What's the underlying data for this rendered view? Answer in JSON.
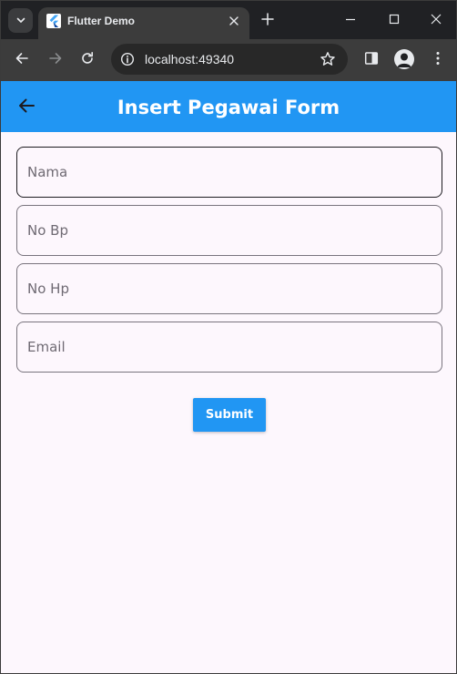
{
  "browser": {
    "tab_title": "Flutter Demo",
    "url": "localhost:49340",
    "theme_dark": "#202124",
    "toolbar_color": "#3c3c3c"
  },
  "appbar": {
    "title": "Insert Pegawai Form",
    "color": "#2196f3"
  },
  "form": {
    "fields": [
      {
        "placeholder": "Nama",
        "value": ""
      },
      {
        "placeholder": "No Bp",
        "value": ""
      },
      {
        "placeholder": "No Hp",
        "value": ""
      },
      {
        "placeholder": "Email",
        "value": ""
      }
    ],
    "submit_label": "Submit"
  },
  "icons": {
    "tab_search": "chevron-down-icon",
    "favicon": "flutter-logo-icon",
    "tab_close": "close-icon",
    "new_tab": "plus-icon",
    "minimize": "minimize-icon",
    "maximize": "maximize-icon",
    "window_close": "close-icon",
    "back": "arrow-left-icon",
    "forward": "arrow-right-icon",
    "reload": "reload-icon",
    "site_info": "info-icon",
    "bookmark": "star-icon",
    "side_panel": "side-panel-icon",
    "profile": "avatar-icon",
    "menu": "kebab-menu-icon",
    "appbar_back": "arrow-left-icon"
  }
}
